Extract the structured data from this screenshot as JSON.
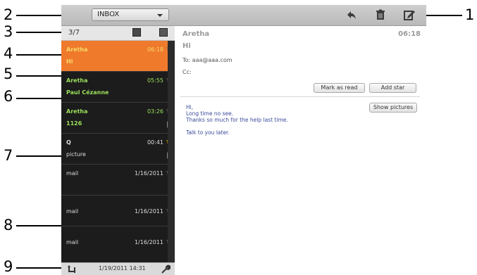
{
  "callouts": {
    "c1": "1",
    "c2": "2",
    "c3": "3",
    "c4": "4",
    "c5": "5",
    "c6": "6",
    "c7": "7",
    "c8": "8",
    "c9": "9"
  },
  "toolbar": {
    "mailbox": "INBOX"
  },
  "list": {
    "count": "3/7",
    "messages": [
      {
        "sender": "Aretha",
        "time": "06:18",
        "subject": "Hi"
      },
      {
        "sender": "Aretha",
        "time": "05:55",
        "subject": "Paul Cézanne"
      },
      {
        "sender": "Aretha",
        "time": "03:26",
        "subject": "1126"
      },
      {
        "sender": "Q",
        "time": "00:41",
        "subject": "picture"
      },
      {
        "sender": "mail",
        "time": "1/16/2011",
        "subject": ""
      },
      {
        "sender": "mail",
        "time": "1/16/2011",
        "subject": ""
      },
      {
        "sender": "mail",
        "time": "1/16/2011",
        "subject": ""
      }
    ],
    "footer_date": "1/19/2011 14:31"
  },
  "reading": {
    "from": "Aretha",
    "time": "06:18",
    "subject": "Hi",
    "to": "To:  aaa@aaa.com",
    "cc": "Cc:",
    "mark_read": "Mark as read",
    "add_star": "Add star",
    "show_pictures": "Show pictures",
    "body": [
      "Hi,",
      "Long time no see.",
      "Thanks so much for the help last time.",
      "",
      "Talk to you later."
    ]
  },
  "colors": {
    "selected": "#f07a2c",
    "green_text": "#9be05a",
    "star_on": "#f5c400"
  }
}
